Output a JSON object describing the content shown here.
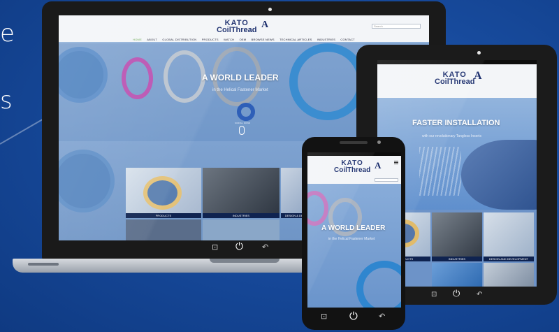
{
  "background": {
    "text_line1": "e",
    "text_line2": "s",
    "color": "#174a9c"
  },
  "brand": {
    "logo_line1": "KATO",
    "logo_line2": "CoilThread",
    "logo_mark": "A"
  },
  "laptop": {
    "nav": [
      "HOME",
      "ABOUT",
      "GLOBAL DISTRIBUTION",
      "PRODUCTS",
      "WATCH",
      "OEM",
      "BROWSE NEWS",
      "TECHNICAL ARTICLES",
      "INDUSTRIES",
      "CONTACT"
    ],
    "search_placeholder": "Search",
    "hero_title": "A WORLD LEADER",
    "hero_subtitle": "in the Helical Fastener Market",
    "scroll_hint": "SCROLL DOWN",
    "tiles": [
      "PRODUCTS",
      "INDUSTRIES",
      "DESIGN & DEV"
    ]
  },
  "tablet": {
    "hero_title": "FASTER INSTALLATION",
    "hero_subtitle": "with our revolutionary Tangless Inserts",
    "tiles": [
      "PRODUCTS",
      "INDUSTRIES",
      "DESIGN AND DEVELOPMENT"
    ]
  },
  "phone": {
    "hero_title": "A WORLD LEADER",
    "hero_subtitle": "in the Helical Fastener Market"
  },
  "hardware_buttons": {
    "recent": "⊡",
    "power": "⏻",
    "back": "↶"
  }
}
